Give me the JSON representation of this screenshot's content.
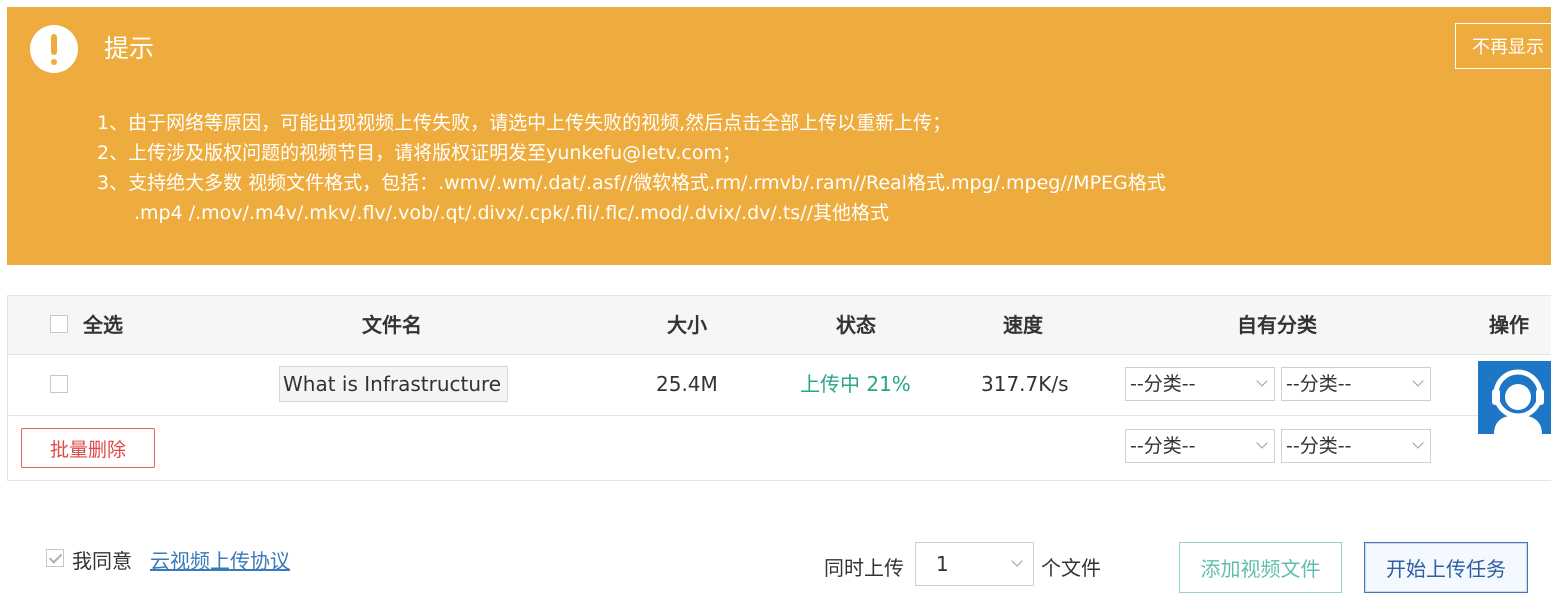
{
  "notice": {
    "title": "提示",
    "close_label": "不再显示",
    "lines": [
      "1、由于网络等原因，可能出现视频上传失败，请选中上传失败的视频,然后点击全部上传以重新上传；",
      "2、上传涉及版权问题的视频节目，请将版权证明发至yunkefu@letv.com；",
      "3、支持绝大多数 视频文件格式，包括：.wmv/.wm/.dat/.asf//微软格式.rm/.rmvb/.ram//Real格式.mpg/.mpeg//MPEG格式",
      ".mp4 /.mov/.m4v/.mkv/.flv/.vob/.qt/.divx/.cpk/.fli/.flc/.mod/.dvix/.dv/.ts//其他格式"
    ]
  },
  "table": {
    "headers": {
      "select_all": "全选",
      "filename": "文件名",
      "size": "大小",
      "status": "状态",
      "speed": "速度",
      "category": "自有分类",
      "actions": "操作"
    },
    "rows": [
      {
        "filename": "What is Infrastructure",
        "size": "25.4M",
        "status": "上传中 21%",
        "speed": "317.7K/s",
        "category1": "--分类--",
        "category2": "--分类--"
      }
    ],
    "batch_delete": "批量删除",
    "batch_category1": "--分类--",
    "batch_category2": "--分类--"
  },
  "footer": {
    "agree_text": "我同意",
    "agree_link": "云视频上传协议",
    "simultaneous_label": "同时上传",
    "simultaneous_value": "1",
    "simultaneous_unit": "个文件",
    "add_button": "添加视频文件",
    "start_button": "开始上传任务"
  },
  "colors": {
    "notice_bg": "#eeac3e",
    "status_green": "#27a58a",
    "delete_red": "#e04848",
    "service_blue": "#1e76c6"
  }
}
